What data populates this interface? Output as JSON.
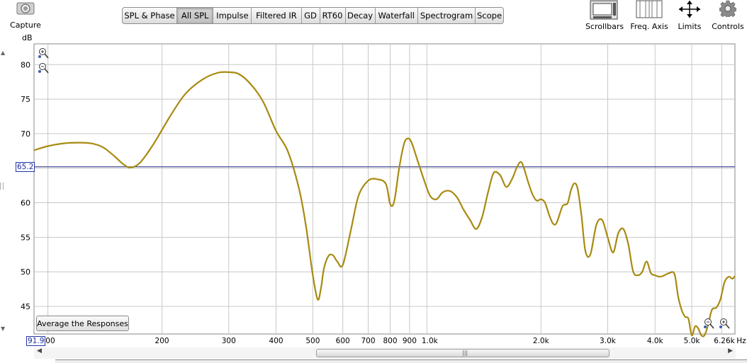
{
  "toolbar": {
    "capture_label": "Capture",
    "scrollbars_label": "Scrollbars",
    "freq_axis_label": "Freq. Axis",
    "limits_label": "Limits",
    "controls_label": "Controls",
    "tabs": [
      {
        "label": "SPL & Phase",
        "active": false
      },
      {
        "label": "All SPL",
        "active": true
      },
      {
        "label": "Impulse",
        "active": false
      },
      {
        "label": "Filtered IR",
        "active": false
      },
      {
        "label": "GD",
        "active": false
      },
      {
        "label": "RT60",
        "active": false
      },
      {
        "label": "Decay",
        "active": false
      },
      {
        "label": "Waterfall",
        "active": false
      },
      {
        "label": "Spectrogram",
        "active": false
      },
      {
        "label": "Scope",
        "active": false
      }
    ]
  },
  "plot": {
    "y_unit": "dB",
    "y_ticks": [
      "45",
      "50",
      "55",
      "60",
      "65",
      "70",
      "75",
      "80"
    ],
    "x_tick_labels": [
      "100",
      "200",
      "300",
      "400",
      "500",
      "600",
      "700",
      "800",
      "900",
      "1.0k",
      "2.0k",
      "3.0k",
      "4.0k",
      "5.0k",
      "6.26k",
      "Hz"
    ],
    "cursor_y_value": "65.2",
    "cursor_x_value": "91.9",
    "average_button_label": "Average the Responses",
    "trace_color": "#a88a10",
    "cursor_color": "#1a237e"
  },
  "chart_data": {
    "type": "line",
    "xlabel": "Hz",
    "ylabel": "dB",
    "x_scale": "log",
    "xlim": [
      91.9,
      6500
    ],
    "ylim": [
      41,
      83
    ],
    "grid": true,
    "cursor_y": 65.2,
    "series": [
      {
        "x": [
          91.9,
          100,
          110,
          120,
          130,
          140,
          150,
          158,
          165,
          175,
          190,
          210,
          230,
          255,
          280,
          300,
          320,
          345,
          370,
          400,
          430,
          460,
          480,
          500,
          515,
          525,
          535,
          550,
          565,
          580,
          600,
          630,
          660,
          700,
          740,
          780,
          800,
          820,
          845,
          870,
          890,
          910,
          940,
          980,
          1020,
          1060,
          1100,
          1150,
          1200,
          1250,
          1300,
          1350,
          1400,
          1450,
          1500,
          1560,
          1620,
          1680,
          1730,
          1780,
          1850,
          1900,
          1950,
          2000,
          2050,
          2100,
          2150,
          2200,
          2280,
          2350,
          2400,
          2450,
          2500,
          2560,
          2620,
          2700,
          2800,
          2900,
          3000,
          3100,
          3200,
          3300,
          3400,
          3500,
          3600,
          3700,
          3800,
          3900,
          4000,
          4100,
          4200,
          4350,
          4500,
          4600,
          4700,
          4800,
          4900,
          5000,
          5100,
          5200,
          5300,
          5400,
          5500,
          5650,
          5800,
          5950,
          6100,
          6260,
          6400,
          6500
        ],
        "y": [
          67.6,
          68.2,
          68.6,
          68.7,
          68.6,
          68.0,
          66.7,
          65.6,
          65.1,
          65.8,
          68.5,
          72.5,
          75.7,
          77.8,
          78.8,
          78.9,
          78.6,
          77.0,
          74.6,
          70.4,
          67.4,
          62.0,
          56.5,
          49.5,
          46.0,
          47.5,
          50.5,
          52.3,
          52.4,
          51.5,
          51.0,
          56.0,
          61.0,
          63.2,
          63.4,
          62.7,
          59.8,
          60.2,
          65.0,
          68.5,
          69.3,
          68.8,
          66.5,
          63.5,
          61.0,
          60.5,
          61.5,
          61.7,
          60.8,
          59.0,
          57.5,
          56.2,
          58.0,
          61.5,
          64.3,
          64.0,
          62.3,
          63.5,
          65.2,
          65.8,
          63.0,
          61.2,
          60.3,
          60.5,
          60.0,
          58.3,
          57.0,
          57.1,
          59.5,
          59.9,
          61.8,
          62.8,
          62.0,
          58.0,
          53.0,
          52.5,
          56.8,
          57.5,
          55.0,
          52.8,
          55.6,
          56.2,
          54.0,
          50.1,
          49.5,
          50.0,
          51.5,
          49.8,
          49.5,
          49.3,
          49.4,
          49.8,
          49.7,
          46.5,
          44.5,
          43.5,
          43.2,
          40.0,
          42.1,
          41.8,
          40.2,
          40.5,
          42.0,
          44.5,
          44.8,
          46.0,
          48.5,
          49.3,
          49.0,
          49.4
        ]
      }
    ]
  }
}
